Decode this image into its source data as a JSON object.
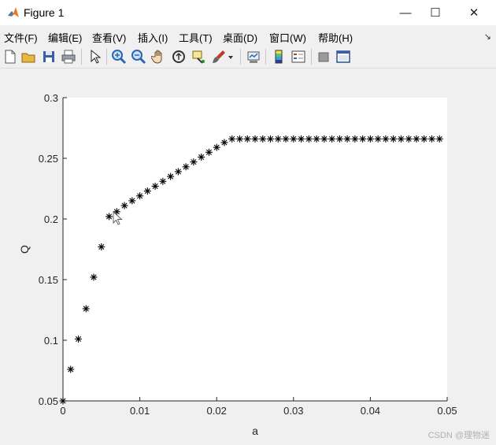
{
  "window": {
    "title": "Figure 1",
    "controls": {
      "minimize": "—",
      "maximize": "☐",
      "close": "✕"
    }
  },
  "menubar": {
    "items": [
      {
        "label": "文件(F)"
      },
      {
        "label": "编辑(E)"
      },
      {
        "label": "查看(V)"
      },
      {
        "label": "插入(I)"
      },
      {
        "label": "工具(T)"
      },
      {
        "label": "桌面(D)"
      },
      {
        "label": "窗口(W)"
      },
      {
        "label": "帮助(H)"
      }
    ],
    "overflow_icon": "corner-arrow-icon"
  },
  "toolbar": {
    "icons": [
      "new-figure-icon",
      "open-file-icon",
      "save-icon",
      "print-icon",
      "select-pointer-icon",
      "zoom-in-icon",
      "zoom-out-icon",
      "pan-hand-icon",
      "rotate-3d-icon",
      "data-cursor-icon",
      "brush-icon",
      "brush-dropdown-icon",
      "link-plot-icon",
      "insert-colorbar-icon",
      "insert-legend-icon",
      "hide-plot-tools-icon",
      "show-plot-tools-icon"
    ]
  },
  "chart_data": {
    "type": "scatter",
    "marker": "*",
    "xlabel": "a",
    "ylabel": "Q",
    "xlim": [
      0,
      0.05
    ],
    "ylim": [
      0.05,
      0.3
    ],
    "xticks": [
      "0",
      "0.01",
      "0.02",
      "0.03",
      "0.04",
      "0.05"
    ],
    "yticks": [
      "0.05",
      "0.1",
      "0.15",
      "0.2",
      "0.25",
      "0.3"
    ],
    "grid": false,
    "series": [
      {
        "x": [
          0,
          0.001,
          0.002,
          0.003,
          0.004,
          0.005,
          0.006,
          0.007,
          0.008,
          0.009,
          0.01,
          0.011,
          0.012,
          0.013,
          0.014,
          0.015,
          0.016,
          0.017,
          0.018,
          0.019,
          0.02,
          0.021,
          0.022,
          0.023,
          0.024,
          0.025,
          0.026,
          0.027,
          0.028,
          0.029,
          0.03,
          0.031,
          0.032,
          0.033,
          0.034,
          0.035,
          0.036,
          0.037,
          0.038,
          0.039,
          0.04,
          0.041,
          0.042,
          0.043,
          0.044,
          0.045,
          0.046,
          0.047,
          0.048,
          0.049
        ],
        "values": [
          0.05,
          0.076,
          0.101,
          0.126,
          0.152,
          0.177,
          0.202,
          0.206,
          0.211,
          0.215,
          0.219,
          0.223,
          0.227,
          0.231,
          0.235,
          0.239,
          0.243,
          0.247,
          0.251,
          0.255,
          0.259,
          0.263,
          0.266,
          0.266,
          0.266,
          0.266,
          0.266,
          0.266,
          0.266,
          0.266,
          0.266,
          0.266,
          0.266,
          0.266,
          0.266,
          0.266,
          0.266,
          0.266,
          0.266,
          0.266,
          0.266,
          0.266,
          0.266,
          0.266,
          0.266,
          0.266,
          0.266,
          0.266,
          0.266,
          0.266
        ]
      }
    ]
  },
  "watermark": "CSDN @理物迷"
}
